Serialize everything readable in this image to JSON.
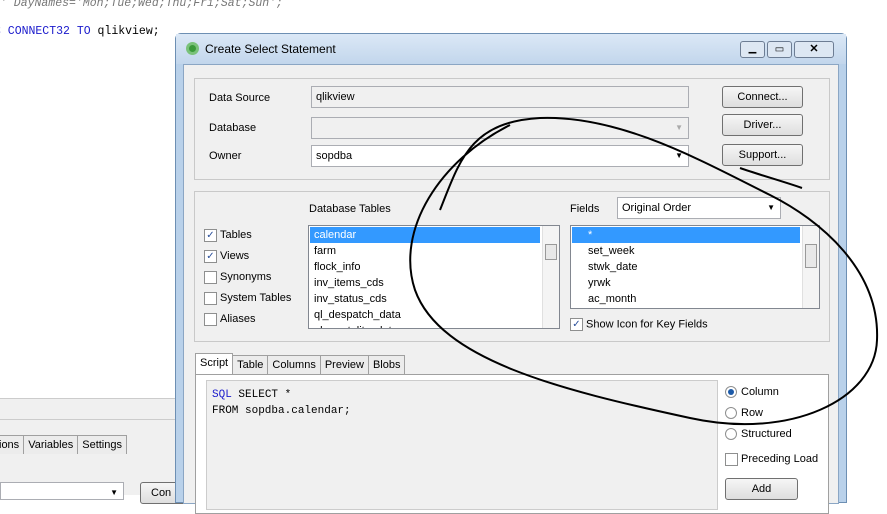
{
  "background": {
    "code_line1": "' DayNames='Mon;Tue;Wed;Thu;Fri;Sat;Sun';",
    "code_line2_kw": "C CONNECT32 TO",
    "code_line2_rest": " qlikview;",
    "tabs": [
      "ions",
      "Variables",
      "Settings"
    ],
    "button_partial": "Con"
  },
  "dialog": {
    "title": "Create Select Statement",
    "data_source_label": "Data Source",
    "data_source_value": "qlikview",
    "database_label": "Database",
    "database_value": "",
    "owner_label": "Owner",
    "owner_value": "sopdba",
    "buttons": {
      "connect": "Connect...",
      "driver": "Driver...",
      "support": "Support...",
      "add": "Add"
    },
    "checkboxes": [
      {
        "label": "Tables",
        "checked": true
      },
      {
        "label": "Views",
        "checked": true
      },
      {
        "label": "Synonyms",
        "checked": false
      },
      {
        "label": "System Tables",
        "checked": false
      },
      {
        "label": "Aliases",
        "checked": false
      }
    ],
    "db_tables_label": "Database Tables",
    "db_tables": [
      "calendar",
      "farm",
      "flock_info",
      "inv_items_cds",
      "inv_status_cds",
      "ql_despatch_data",
      "ql_mortality_data"
    ],
    "fields_label": "Fields",
    "fields_order": "Original Order",
    "fields": [
      "*",
      "set_week",
      "stwk_date",
      "yrwk",
      "ac_month"
    ],
    "show_icon_label": "Show Icon for Key Fields",
    "tabs": [
      "Script",
      "Table",
      "Columns",
      "Preview",
      "Blobs"
    ],
    "script_kw": "SQL",
    "script_line1": " SELECT *",
    "script_line2": "FROM sopdba.calendar;",
    "radios": [
      {
        "label": "Column",
        "selected": true
      },
      {
        "label": "Row",
        "selected": false
      },
      {
        "label": "Structured",
        "selected": false
      }
    ],
    "preceding_load_label": "Preceding Load"
  }
}
